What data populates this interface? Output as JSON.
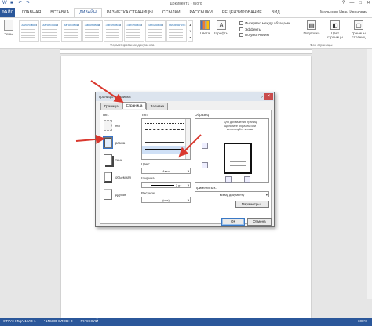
{
  "window": {
    "title": "Документ1 - Word",
    "controls": [
      "?",
      "—",
      "□",
      "✕"
    ]
  },
  "ribbon_tabs": {
    "file": "ФАЙЛ",
    "items": [
      "ГЛАВНАЯ",
      "ВСТАВКА",
      "ДИЗАЙН",
      "РАЗМЕТКА СТРАНИЦЫ",
      "ССЫЛКИ",
      "РАССЫЛКИ",
      "РЕЦЕНЗИРОВАНИЕ",
      "ВИД"
    ],
    "active_index": 2,
    "user": "Малышев Иван Иванович"
  },
  "ribbon": {
    "themes_label": "Темы",
    "gallery_titles": [
      "Заголовок",
      "Заголовок",
      "Заголовок",
      "Заголовок",
      "Заголовок",
      "Заголовок",
      "Заголовок",
      "НАЗВАНИЕ"
    ],
    "gallery_label": "Форматирование документа",
    "colors_label": "Цвета",
    "fonts_label": "Шрифты",
    "options": [
      "Интервал между абзацами",
      "Эффекты",
      "По умолчанию"
    ],
    "watermark_label": "Подложка",
    "page_color_label": "Цвет страницы",
    "page_borders_label": "Границы страниц",
    "page_bg_label": "Фон страницы"
  },
  "dialog": {
    "title": "Границы и заливка",
    "tabs": [
      "Граница",
      "Страница",
      "Заливка"
    ],
    "active_tab": 1,
    "type_label": "Тип:",
    "types": [
      "нет",
      "рамка",
      "тень",
      "объемная",
      "другая"
    ],
    "selected_type": 1,
    "style_label": "Тип:",
    "color_label": "Цвет:",
    "color_value": "Авто",
    "width_label": "Ширина:",
    "width_value": "3 пт",
    "art_label": "Рисунок:",
    "art_value": "(нет)",
    "preview_label": "Образец",
    "preview_hint": "Для добавления границ щелкните образец или используйте кнопки",
    "apply_label": "Применить к:",
    "apply_value": "всему документу",
    "options_button": "Параметры...",
    "ok_button": "ОК",
    "cancel_button": "Отмена"
  },
  "statusbar": {
    "page": "СТРАНИЦА 1 ИЗ 1",
    "words": "ЧИСЛО СЛОВ: 0",
    "lang": "РУССКИЙ",
    "zoom": "100%"
  },
  "colors": {
    "accent": "#2b579a",
    "arrow": "#d9382e"
  }
}
